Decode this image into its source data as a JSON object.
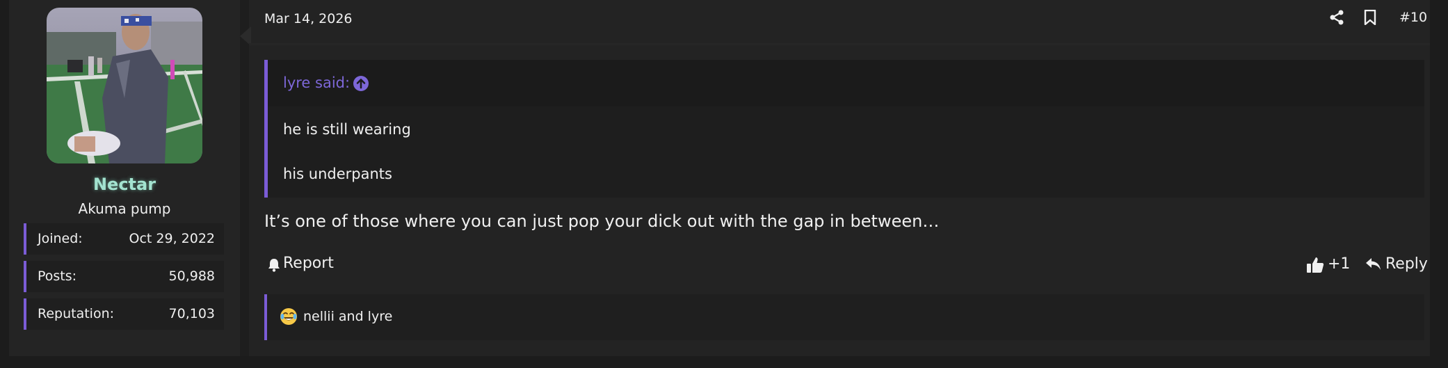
{
  "post": {
    "date": "Mar 14, 2026",
    "number": "#10",
    "icons": {
      "share": "share-icon",
      "bookmark": "bookmark-icon"
    }
  },
  "user": {
    "name": "Nectar",
    "title": "Akuma pump",
    "stats": [
      {
        "label": "Joined:",
        "value": "Oct 29, 2022"
      },
      {
        "label": "Posts:",
        "value": "50,988"
      },
      {
        "label": "Reputation:",
        "value": "70,103"
      }
    ]
  },
  "quote": {
    "author": "lyre said:",
    "lines": [
      "he is still wearing",
      "his underpants"
    ]
  },
  "body": "It’s one of those where you can just pop your dick out with the gap in between…",
  "actions": {
    "report": "Report",
    "like_count": "+1",
    "reply": "Reply"
  },
  "reactions": {
    "emoji": "crying-laughing-emoji",
    "text": "nellii and lyre"
  },
  "colors": {
    "accent": "#7b5cd6",
    "username": "#a3e3d0",
    "background": "#232323"
  }
}
